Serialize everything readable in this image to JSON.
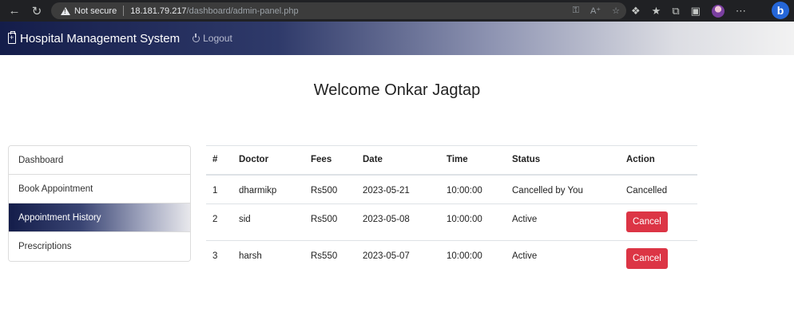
{
  "browser": {
    "security_label": "Not secure",
    "url_host": "18.181.79.217",
    "url_path": "/dashboard/admin-panel.php",
    "bing_label": "b"
  },
  "navbar": {
    "brand": "Hospital Management System",
    "logout": "Logout"
  },
  "welcome": "Welcome  Onkar Jagtap",
  "sidebar": {
    "items": [
      {
        "label": "Dashboard"
      },
      {
        "label": "Book Appointment"
      },
      {
        "label": "Appointment History"
      },
      {
        "label": "Prescriptions"
      }
    ],
    "active_item": "Appointment History"
  },
  "table": {
    "headers": [
      "#",
      "Doctor",
      "Fees",
      "Date",
      "Time",
      "Status",
      "Action"
    ],
    "rows": [
      {
        "num": "1",
        "doctor": "dharmikp",
        "fees": "Rs500",
        "date": "2023-05-21",
        "time": "10:00:00",
        "status": "Cancelled by You",
        "action": "Cancelled"
      },
      {
        "num": "2",
        "doctor": "sid",
        "fees": "Rs500",
        "date": "2023-05-08",
        "time": "10:00:00",
        "status": "Active",
        "action": "Cancel"
      },
      {
        "num": "3",
        "doctor": "harsh",
        "fees": "Rs550",
        "date": "2023-05-07",
        "time": "10:00:00",
        "status": "Active",
        "action": "Cancel"
      }
    ]
  },
  "colors": {
    "cancel_button": "#dc3545",
    "navbar_dark": "#141d4a"
  }
}
